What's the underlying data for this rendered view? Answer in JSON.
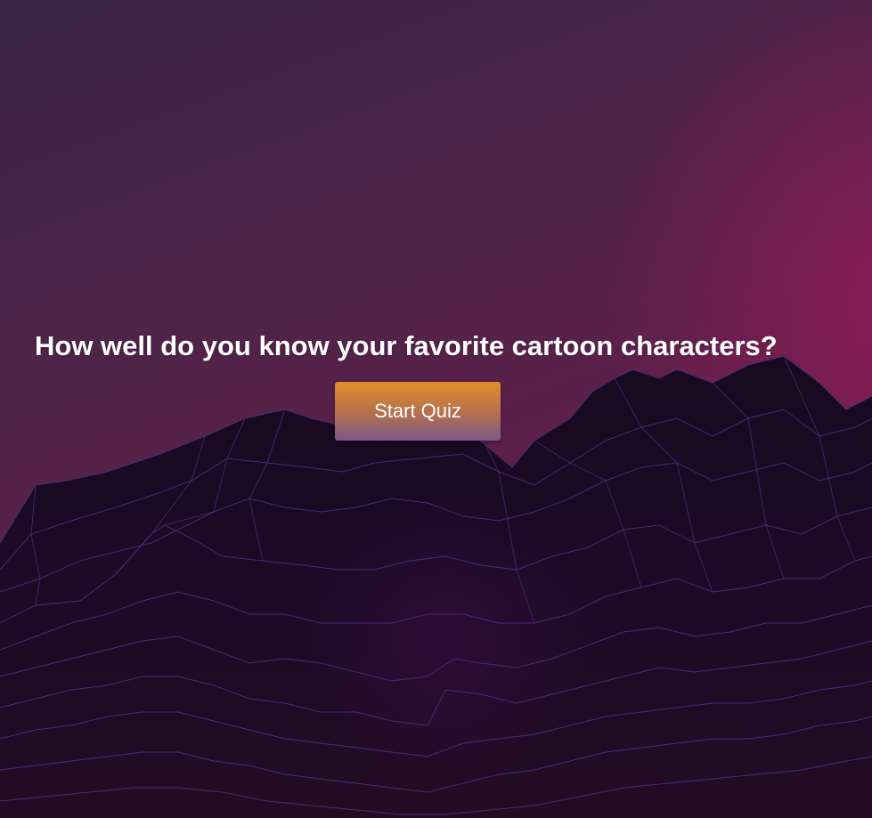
{
  "quiz": {
    "headline": "How well do you know your favorite cartoon characters?",
    "start_button_label": "Start Quiz"
  },
  "colors": {
    "background_top": "#3a2447",
    "background_glow": "#961c5a",
    "mountain_fill": "#1a0a24",
    "mountain_lines": "#4a3280",
    "button_top": "#e28d2c",
    "button_bottom": "#7a5888",
    "text": "#ffffff"
  }
}
